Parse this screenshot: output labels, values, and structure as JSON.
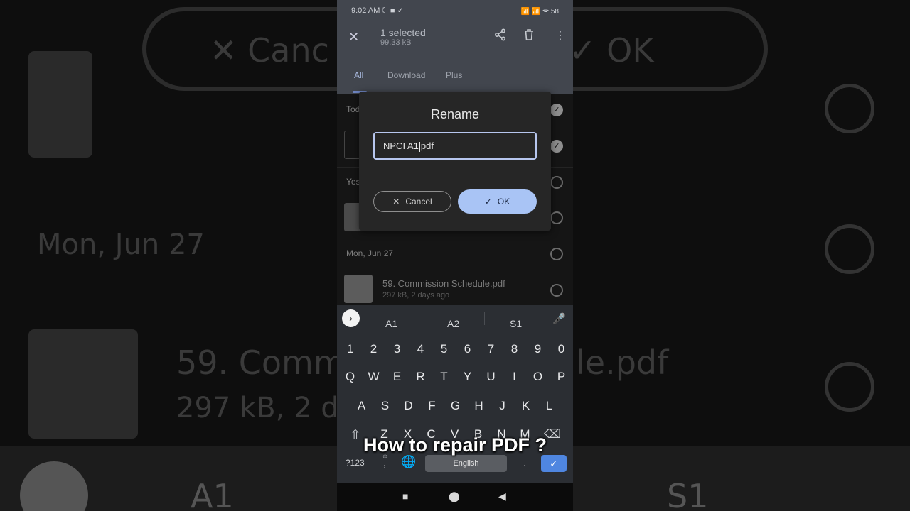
{
  "background": {
    "cancel_text": "✕  Canc",
    "ok_text": "✓  OK",
    "date_text": "Mon, Jun 27",
    "file_text": "59. Comm",
    "file_text_end": "le.pdf",
    "meta_text": "297 kB, 2 d",
    "sugg_a1": "A1",
    "sugg_s1": "S1"
  },
  "status_bar": {
    "time": "9:02 AM",
    "icons": "☾ ■ ✓",
    "right": "📶 📶 ᯤ 58"
  },
  "app_bar": {
    "selection_title": "1 selected",
    "selection_size": "99.33 kB",
    "tabs": [
      "All",
      "Download",
      "Plus"
    ]
  },
  "list": {
    "section_today": "Tod",
    "section_yesterday": "Yes",
    "section_mon": "Mon, Jun 27",
    "file_name": "59. Commission Schedule.pdf",
    "file_meta": "297 kB, 2 days ago"
  },
  "dialog": {
    "title": "Rename",
    "input_prefix": "NPCI ",
    "input_selected": "A1",
    "input_suffix": "pdf",
    "cancel_label": "Cancel",
    "ok_label": "OK"
  },
  "keyboard": {
    "suggestions": [
      "A1",
      "A2",
      "S1"
    ],
    "row_numbers": [
      "1",
      "2",
      "3",
      "4",
      "5",
      "6",
      "7",
      "8",
      "9",
      "0"
    ],
    "row_1": [
      "Q",
      "W",
      "E",
      "R",
      "T",
      "Y",
      "U",
      "I",
      "O",
      "P"
    ],
    "row_2": [
      "A",
      "S",
      "D",
      "F",
      "G",
      "H",
      "J",
      "K",
      "L"
    ],
    "row_3": [
      "Z",
      "X",
      "C",
      "V",
      "B",
      "N",
      "M"
    ],
    "symbols_label": "?123",
    "comma_label": ",",
    "space_label": "English",
    "period_label": "."
  },
  "caption": "How to repair PDF ?"
}
